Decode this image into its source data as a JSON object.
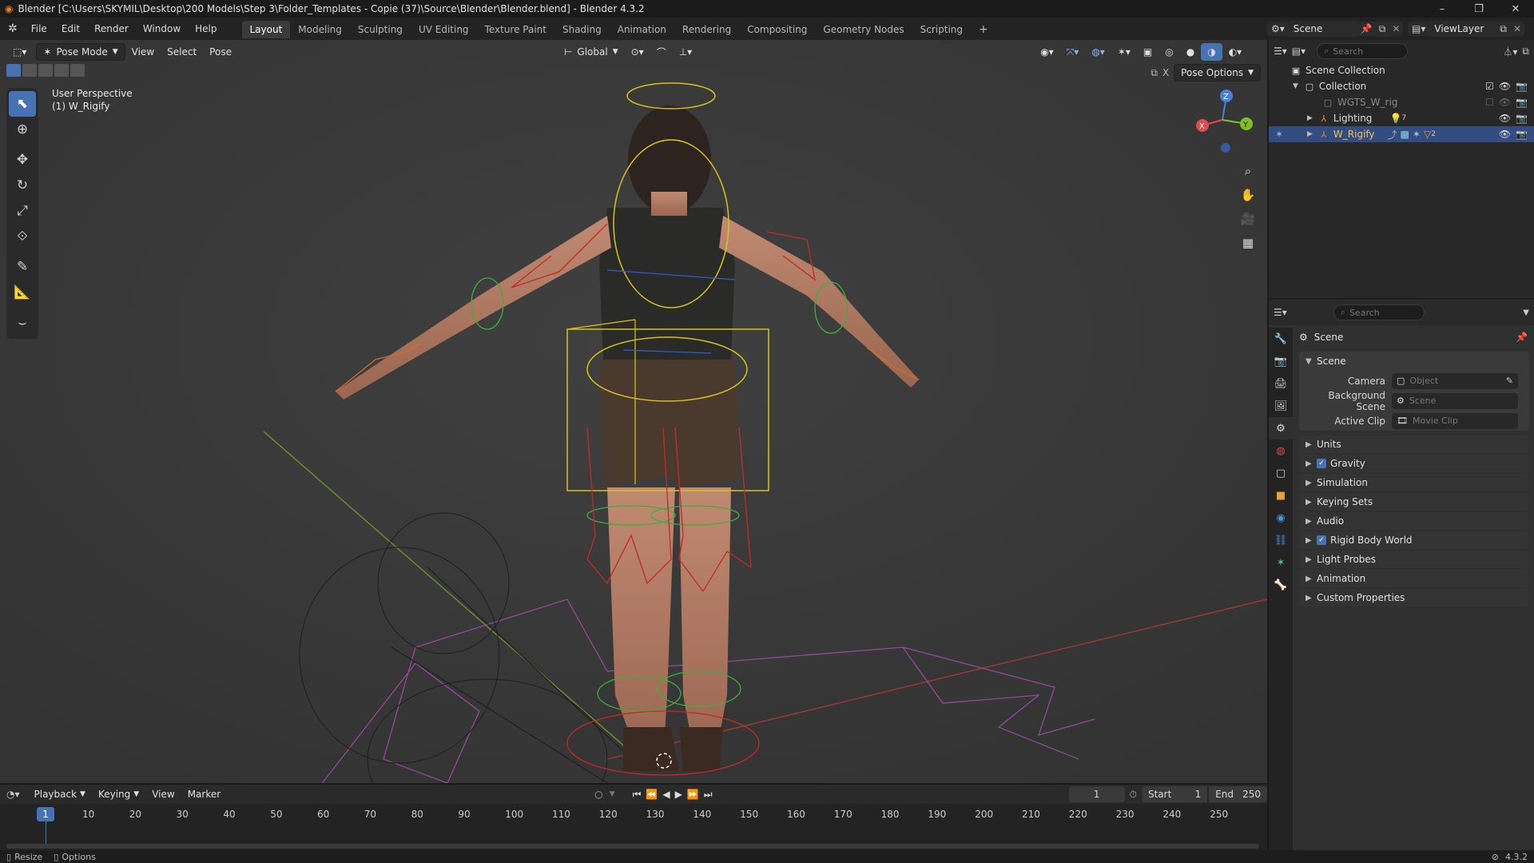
{
  "window": {
    "title": "Blender [C:\\Users\\SKYMIL\\Desktop\\200 Models\\Step 3\\Folder_Templates - Copie (37)\\Source\\Blender\\Blender.blend] - Blender 4.3.2",
    "controls": {
      "minimize": "–",
      "maximize": "❐",
      "close": "✕"
    }
  },
  "menubar": {
    "items": [
      "File",
      "Edit",
      "Render",
      "Window",
      "Help"
    ],
    "workspaces": [
      "Layout",
      "Modeling",
      "Sculpting",
      "UV Editing",
      "Texture Paint",
      "Shading",
      "Animation",
      "Rendering",
      "Compositing",
      "Geometry Nodes",
      "Scripting"
    ],
    "add_tab": "+",
    "scene_name": "Scene",
    "view_layer": "ViewLayer"
  },
  "viewport": {
    "mode": "Pose Mode",
    "menus": [
      "View",
      "Select",
      "Pose"
    ],
    "orientation": "Global",
    "pose_options": "Pose Options",
    "perspective_label": "User Perspective",
    "object_label": "(1) W_Rigify",
    "gizmo": {
      "z": "Z",
      "y": "Y",
      "x": "X"
    },
    "accent": "#4772b3"
  },
  "outliner": {
    "search_placeholder": "Search",
    "root": "Scene Collection",
    "collection": "Collection",
    "items": [
      {
        "name": "WGTS_W_rig"
      },
      {
        "name": "Lighting",
        "badge": "7"
      },
      {
        "name": "W_Rigify",
        "badge": "2"
      }
    ]
  },
  "properties": {
    "search_placeholder": "Search",
    "context_title": "Scene",
    "panel_title": "Scene",
    "fields": [
      {
        "label": "Camera",
        "placeholder": "Object"
      },
      {
        "label": "Background Scene",
        "placeholder": "Scene"
      },
      {
        "label": "Active Clip",
        "placeholder": "Movie Clip"
      }
    ],
    "subpanels": [
      {
        "label": "Units",
        "checked": false
      },
      {
        "label": "Gravity",
        "checked": true
      },
      {
        "label": "Simulation",
        "checked": false
      },
      {
        "label": "Keying Sets",
        "checked": false
      },
      {
        "label": "Audio",
        "checked": false
      },
      {
        "label": "Rigid Body World",
        "checked": true
      },
      {
        "label": "Light Probes",
        "checked": false
      },
      {
        "label": "Animation",
        "checked": false
      },
      {
        "label": "Custom Properties",
        "checked": false
      }
    ]
  },
  "timeline": {
    "menus": [
      "Playback",
      "Keying",
      "View",
      "Marker"
    ],
    "current_frame": "1",
    "start_label": "Start",
    "start": "1",
    "end_label": "End",
    "end": "250",
    "ticks": [
      "10",
      "20",
      "30",
      "40",
      "50",
      "60",
      "70",
      "80",
      "90",
      "100",
      "110",
      "120",
      "130",
      "140",
      "150",
      "160",
      "170",
      "180",
      "190",
      "200",
      "210",
      "220",
      "230",
      "240",
      "250"
    ]
  },
  "statusbar": {
    "left1": "Resize",
    "left2": "Options",
    "version": "4.3.2"
  }
}
